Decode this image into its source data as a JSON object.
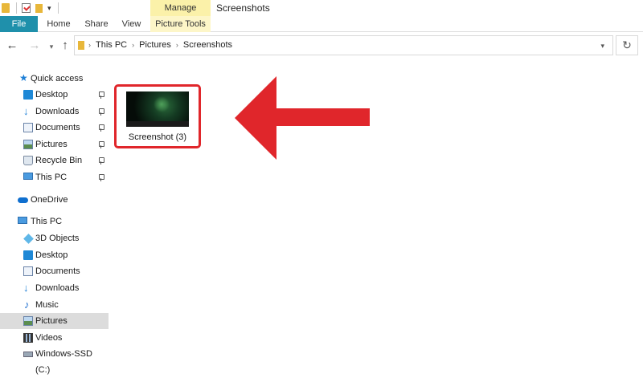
{
  "window": {
    "title": "Screenshots"
  },
  "titlebar": {
    "contextual_tab": "Manage"
  },
  "ribbon": {
    "tabs": [
      "File",
      "Home",
      "Share",
      "View"
    ],
    "contextual_tab_group": "Picture Tools"
  },
  "address": {
    "crumbs": [
      "This PC",
      "Pictures",
      "Screenshots"
    ]
  },
  "navpane": {
    "items": [
      {
        "label": "Quick access",
        "icon": "star-icon",
        "pinned": false
      },
      {
        "label": "Desktop",
        "icon": "desktop-icon",
        "pinned": true
      },
      {
        "label": "Downloads",
        "icon": "download-icon",
        "pinned": true
      },
      {
        "label": "Documents",
        "icon": "documents-icon",
        "pinned": true
      },
      {
        "label": "Pictures",
        "icon": "pictures-icon",
        "pinned": true
      },
      {
        "label": "Recycle Bin",
        "icon": "recycle-bin-icon",
        "pinned": true
      },
      {
        "label": "This PC",
        "icon": "this-pc-icon",
        "pinned": true
      },
      {
        "label": "OneDrive",
        "icon": "cloud-icon",
        "pinned": false
      },
      {
        "label": "This PC",
        "icon": "this-pc-icon",
        "pinned": false
      },
      {
        "label": "3D Objects",
        "icon": "3d-objects-icon",
        "pinned": false
      },
      {
        "label": "Desktop",
        "icon": "desktop-icon",
        "pinned": false
      },
      {
        "label": "Documents",
        "icon": "documents-icon",
        "pinned": false
      },
      {
        "label": "Downloads",
        "icon": "download-icon",
        "pinned": false
      },
      {
        "label": "Music",
        "icon": "music-icon",
        "pinned": false
      },
      {
        "label": "Pictures",
        "icon": "pictures-icon",
        "pinned": false,
        "selected": true
      },
      {
        "label": "Videos",
        "icon": "videos-icon",
        "pinned": false
      },
      {
        "label": "Windows-SSD (C:)",
        "icon": "drive-icon",
        "pinned": false
      }
    ]
  },
  "content": {
    "files": [
      {
        "name": "Screenshot (3)",
        "highlighted": true
      }
    ]
  },
  "colors": {
    "highlight_red": "#e0262b",
    "file_tab": "#1f90ab",
    "manage_tab": "#fbf1a9"
  }
}
